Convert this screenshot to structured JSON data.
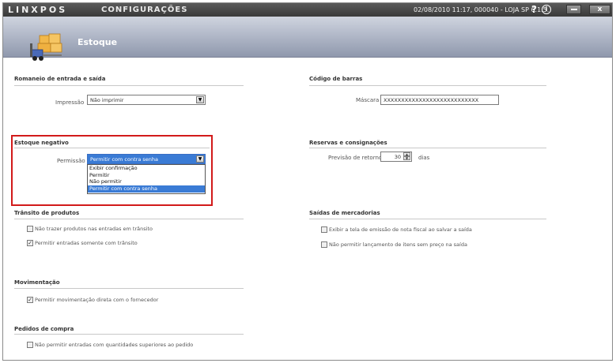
{
  "titlebar": {
    "logo": "LINXPOS",
    "title": "CONFIGURAÇÕES",
    "status": "02/08/2010 11:17, 000040 - LOJA SP 6.1.5.",
    "help": "?",
    "info": "i",
    "close": "x"
  },
  "header": {
    "title": "Estoque"
  },
  "romaneio": {
    "title": "Romaneio de entrada e saída",
    "impressao_label": "Impressão",
    "impressao_value": "Não imprimir"
  },
  "codigo_barras": {
    "title": "Código de barras",
    "mascara_label": "Máscara",
    "mascara_value": "XXXXXXXXXXXXXXXXXXXXXXXXXXX"
  },
  "estoque_negativo": {
    "title": "Estoque negativo",
    "permissao_label": "Permissão",
    "permissao_value": "Permitir com contra senha",
    "options": [
      "Exibir confirmação",
      "Permitir",
      "Não permitir",
      "Permitir com contra senha"
    ]
  },
  "reservas": {
    "title": "Reservas e consignações",
    "previsao_label": "Previsão de retorno",
    "previsao_value": "30",
    "dias_label": "dias"
  },
  "transito": {
    "title": "Trânsito de produtos",
    "opt1": "Não trazer produtos nas entradas em trânsito",
    "opt2": "Permitir entradas somente com trânsito"
  },
  "saidas": {
    "title": "Saídas de mercadorias",
    "opt1": "Exibir a tela de emissão de nota fiscal ao salvar a saída",
    "opt2": "Não permitir lançamento de itens sem preço na saída"
  },
  "movimentacao": {
    "title": "Movimentação",
    "opt1": "Permitir movimentação direta com o fornecedor"
  },
  "pedidos": {
    "title": "Pedidos de compra",
    "opt1": "Não permitir entradas com quantidades superiores ao pedido"
  },
  "checks": {
    "checked": "✓",
    "unchecked": ""
  }
}
